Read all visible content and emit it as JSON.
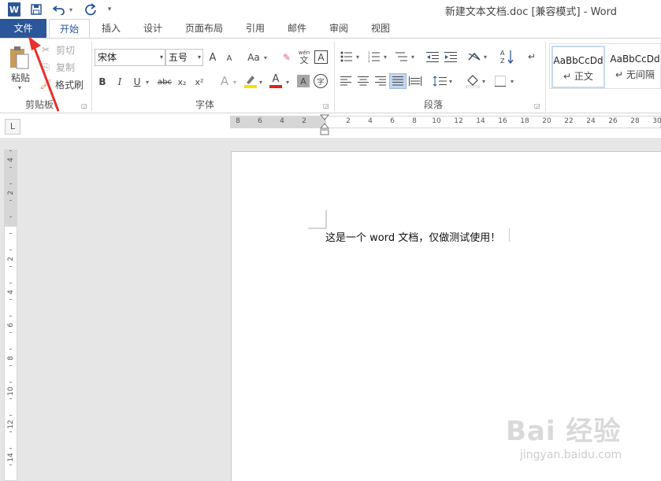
{
  "titlebar": {
    "app_logo": "W",
    "title": "新建文本文档.doc [兼容模式] - Word"
  },
  "tabs": [
    {
      "label": "文件"
    },
    {
      "label": "开始"
    },
    {
      "label": "插入"
    },
    {
      "label": "设计"
    },
    {
      "label": "页面布局"
    },
    {
      "label": "引用"
    },
    {
      "label": "邮件"
    },
    {
      "label": "审阅"
    },
    {
      "label": "视图"
    }
  ],
  "ribbon": {
    "clipboard": {
      "paste": "粘贴",
      "cut": "剪切",
      "copy": "复制",
      "format_painter": "格式刷",
      "group": "剪贴板"
    },
    "font": {
      "font_name": "宋体",
      "font_size": "五号",
      "change_case": "Aa",
      "bold": "B",
      "italic": "I",
      "underline": "U",
      "strikethrough": "abc",
      "subscript": "x₂",
      "superscript": "x²",
      "pinyin_top": "wén",
      "pinyin_bottom": "文",
      "char_border": "A",
      "text_effect": "A",
      "font_color": "A",
      "char_shading": "A",
      "enclose": "字",
      "grow": "A",
      "shrink": "A",
      "group": "字体"
    },
    "paragraph": {
      "group": "段落"
    },
    "styles": {
      "preview": "AaBbCcDd",
      "items": [
        {
          "name": "正文"
        },
        {
          "name": "无间隔"
        }
      ]
    }
  },
  "ruler": {
    "corner": "L",
    "h_numbers": [
      "8",
      "6",
      "4",
      "2",
      "2",
      "4",
      "6",
      "8",
      "10",
      "12",
      "14",
      "16",
      "18",
      "20",
      "22",
      "24",
      "26",
      "28",
      "30"
    ],
    "v_numbers": [
      "4",
      "2",
      "2",
      "4",
      "6",
      "8",
      "10",
      "12",
      "14"
    ]
  },
  "document": {
    "text": "这是一个 word 文档，仅做测试使用！"
  },
  "watermark": {
    "main": "Bai 经验",
    "sub": "jingyan.baidu.com"
  },
  "colors": {
    "accent": "#2b579a",
    "annotation": "#e8302c",
    "highlight": "#f5e100",
    "font_color": "#e01f1f"
  }
}
